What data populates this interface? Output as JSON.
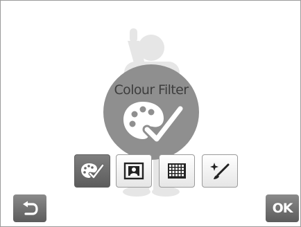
{
  "mode": {
    "title": "Colour Filter",
    "icon": "palette-check-icon"
  },
  "options": [
    {
      "icon": "palette-check-icon",
      "selected": true
    },
    {
      "icon": "portrait-frame-icon",
      "selected": false
    },
    {
      "icon": "grid-icon",
      "selected": false
    },
    {
      "icon": "sparkle-brush-icon",
      "selected": false
    }
  ],
  "controls": {
    "back_icon": "back-arrow-icon",
    "ok_label": "OK"
  },
  "colors": {
    "circle": "#8f8f8f",
    "silhouette": "#e6e6e6",
    "button_dark": "#5c5c5c"
  }
}
